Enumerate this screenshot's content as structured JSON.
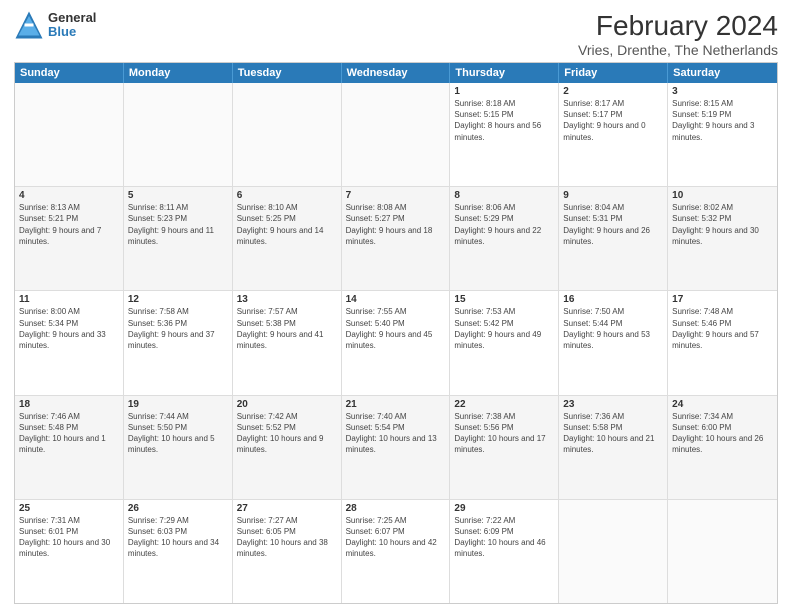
{
  "logo": {
    "line1": "General",
    "line2": "Blue"
  },
  "title": "February 2024",
  "subtitle": "Vries, Drenthe, The Netherlands",
  "header": {
    "days": [
      "Sunday",
      "Monday",
      "Tuesday",
      "Wednesday",
      "Thursday",
      "Friday",
      "Saturday"
    ]
  },
  "rows": [
    {
      "cells": [
        {
          "empty": true
        },
        {
          "empty": true
        },
        {
          "empty": true
        },
        {
          "empty": true
        },
        {
          "day": "1",
          "sunrise": "8:18 AM",
          "sunset": "5:15 PM",
          "daylight": "8 hours and 56 minutes."
        },
        {
          "day": "2",
          "sunrise": "8:17 AM",
          "sunset": "5:17 PM",
          "daylight": "9 hours and 0 minutes."
        },
        {
          "day": "3",
          "sunrise": "8:15 AM",
          "sunset": "5:19 PM",
          "daylight": "9 hours and 3 minutes."
        }
      ]
    },
    {
      "alt": true,
      "cells": [
        {
          "day": "4",
          "sunrise": "8:13 AM",
          "sunset": "5:21 PM",
          "daylight": "9 hours and 7 minutes."
        },
        {
          "day": "5",
          "sunrise": "8:11 AM",
          "sunset": "5:23 PM",
          "daylight": "9 hours and 11 minutes."
        },
        {
          "day": "6",
          "sunrise": "8:10 AM",
          "sunset": "5:25 PM",
          "daylight": "9 hours and 14 minutes."
        },
        {
          "day": "7",
          "sunrise": "8:08 AM",
          "sunset": "5:27 PM",
          "daylight": "9 hours and 18 minutes."
        },
        {
          "day": "8",
          "sunrise": "8:06 AM",
          "sunset": "5:29 PM",
          "daylight": "9 hours and 22 minutes."
        },
        {
          "day": "9",
          "sunrise": "8:04 AM",
          "sunset": "5:31 PM",
          "daylight": "9 hours and 26 minutes."
        },
        {
          "day": "10",
          "sunrise": "8:02 AM",
          "sunset": "5:32 PM",
          "daylight": "9 hours and 30 minutes."
        }
      ]
    },
    {
      "cells": [
        {
          "day": "11",
          "sunrise": "8:00 AM",
          "sunset": "5:34 PM",
          "daylight": "9 hours and 33 minutes."
        },
        {
          "day": "12",
          "sunrise": "7:58 AM",
          "sunset": "5:36 PM",
          "daylight": "9 hours and 37 minutes."
        },
        {
          "day": "13",
          "sunrise": "7:57 AM",
          "sunset": "5:38 PM",
          "daylight": "9 hours and 41 minutes."
        },
        {
          "day": "14",
          "sunrise": "7:55 AM",
          "sunset": "5:40 PM",
          "daylight": "9 hours and 45 minutes."
        },
        {
          "day": "15",
          "sunrise": "7:53 AM",
          "sunset": "5:42 PM",
          "daylight": "9 hours and 49 minutes."
        },
        {
          "day": "16",
          "sunrise": "7:50 AM",
          "sunset": "5:44 PM",
          "daylight": "9 hours and 53 minutes."
        },
        {
          "day": "17",
          "sunrise": "7:48 AM",
          "sunset": "5:46 PM",
          "daylight": "9 hours and 57 minutes."
        }
      ]
    },
    {
      "alt": true,
      "cells": [
        {
          "day": "18",
          "sunrise": "7:46 AM",
          "sunset": "5:48 PM",
          "daylight": "10 hours and 1 minute."
        },
        {
          "day": "19",
          "sunrise": "7:44 AM",
          "sunset": "5:50 PM",
          "daylight": "10 hours and 5 minutes."
        },
        {
          "day": "20",
          "sunrise": "7:42 AM",
          "sunset": "5:52 PM",
          "daylight": "10 hours and 9 minutes."
        },
        {
          "day": "21",
          "sunrise": "7:40 AM",
          "sunset": "5:54 PM",
          "daylight": "10 hours and 13 minutes."
        },
        {
          "day": "22",
          "sunrise": "7:38 AM",
          "sunset": "5:56 PM",
          "daylight": "10 hours and 17 minutes."
        },
        {
          "day": "23",
          "sunrise": "7:36 AM",
          "sunset": "5:58 PM",
          "daylight": "10 hours and 21 minutes."
        },
        {
          "day": "24",
          "sunrise": "7:34 AM",
          "sunset": "6:00 PM",
          "daylight": "10 hours and 26 minutes."
        }
      ]
    },
    {
      "cells": [
        {
          "day": "25",
          "sunrise": "7:31 AM",
          "sunset": "6:01 PM",
          "daylight": "10 hours and 30 minutes."
        },
        {
          "day": "26",
          "sunrise": "7:29 AM",
          "sunset": "6:03 PM",
          "daylight": "10 hours and 34 minutes."
        },
        {
          "day": "27",
          "sunrise": "7:27 AM",
          "sunset": "6:05 PM",
          "daylight": "10 hours and 38 minutes."
        },
        {
          "day": "28",
          "sunrise": "7:25 AM",
          "sunset": "6:07 PM",
          "daylight": "10 hours and 42 minutes."
        },
        {
          "day": "29",
          "sunrise": "7:22 AM",
          "sunset": "6:09 PM",
          "daylight": "10 hours and 46 minutes."
        },
        {
          "empty": true
        },
        {
          "empty": true
        }
      ]
    }
  ]
}
